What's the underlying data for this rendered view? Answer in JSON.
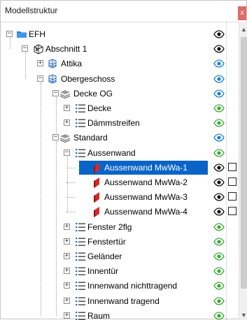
{
  "panel": {
    "title": "Modellstruktur",
    "close": "x"
  },
  "tree": [
    {
      "label": "EFH",
      "level": 0,
      "expander": "minus",
      "icon": "folder-icon",
      "eye": "dark",
      "check": false
    },
    {
      "label": "Abschnitt 1",
      "level": 1,
      "expander": "minus",
      "icon": "section-icon",
      "eye": "dark",
      "check": false
    },
    {
      "label": "Attika",
      "level": 2,
      "expander": "plus",
      "icon": "storey-icon",
      "eye": "blue",
      "check": false
    },
    {
      "label": "Obergeschoss",
      "level": 2,
      "expander": "minus",
      "icon": "storey-icon",
      "eye": "blue",
      "check": false
    },
    {
      "label": "Decke OG",
      "level": 3,
      "expander": "minus",
      "icon": "layer-icon",
      "eye": "blue",
      "check": false
    },
    {
      "label": "Decke",
      "level": 4,
      "expander": "plus",
      "icon": "list-icon",
      "eye": "green",
      "check": false
    },
    {
      "label": "Dämmstreifen",
      "level": 4,
      "expander": "plus",
      "icon": "list-icon",
      "eye": "green",
      "check": false
    },
    {
      "label": "Standard",
      "level": 3,
      "expander": "minus",
      "icon": "layer-icon",
      "eye": "blue",
      "check": false
    },
    {
      "label": "Aussenwand",
      "level": 4,
      "expander": "minus",
      "icon": "list-icon",
      "eye": "green",
      "check": false
    },
    {
      "label": "Aussenwand MwWa-1",
      "level": 5,
      "expander": "none",
      "icon": "wall-icon",
      "eye": "dark",
      "check": true,
      "selected": true
    },
    {
      "label": "Aussenwand MwWa-2",
      "level": 5,
      "expander": "none",
      "icon": "wall-icon",
      "eye": "dark",
      "check": true
    },
    {
      "label": "Aussenwand MwWa-3",
      "level": 5,
      "expander": "none",
      "icon": "wall-icon",
      "eye": "dark",
      "check": true
    },
    {
      "label": "Aussenwand MwWa-4",
      "level": 5,
      "expander": "none",
      "icon": "wall-icon",
      "eye": "dark",
      "check": true
    },
    {
      "label": "Fenster 2flg",
      "level": 4,
      "expander": "plus",
      "icon": "list-icon",
      "eye": "green",
      "check": false
    },
    {
      "label": "Fenstertür",
      "level": 4,
      "expander": "plus",
      "icon": "list-icon",
      "eye": "green",
      "check": false
    },
    {
      "label": "Geländer",
      "level": 4,
      "expander": "plus",
      "icon": "list-icon",
      "eye": "green",
      "check": false
    },
    {
      "label": "Innentür",
      "level": 4,
      "expander": "plus",
      "icon": "list-icon",
      "eye": "green",
      "check": false
    },
    {
      "label": "Innenwand nichttragend",
      "level": 4,
      "expander": "plus",
      "icon": "list-icon",
      "eye": "green",
      "check": false
    },
    {
      "label": "Innenwand tragend",
      "level": 4,
      "expander": "plus",
      "icon": "list-icon",
      "eye": "green",
      "check": false
    },
    {
      "label": "Raum",
      "level": 4,
      "expander": "plus",
      "icon": "list-icon",
      "eye": "green",
      "check": false
    }
  ],
  "colors": {
    "selection": "#0a64c8",
    "folder": "#1e78d7",
    "wall": "#d42a2a",
    "eye_green": "#3aa935",
    "eye_blue": "#1c7fd6",
    "eye_dark": "#111111"
  }
}
